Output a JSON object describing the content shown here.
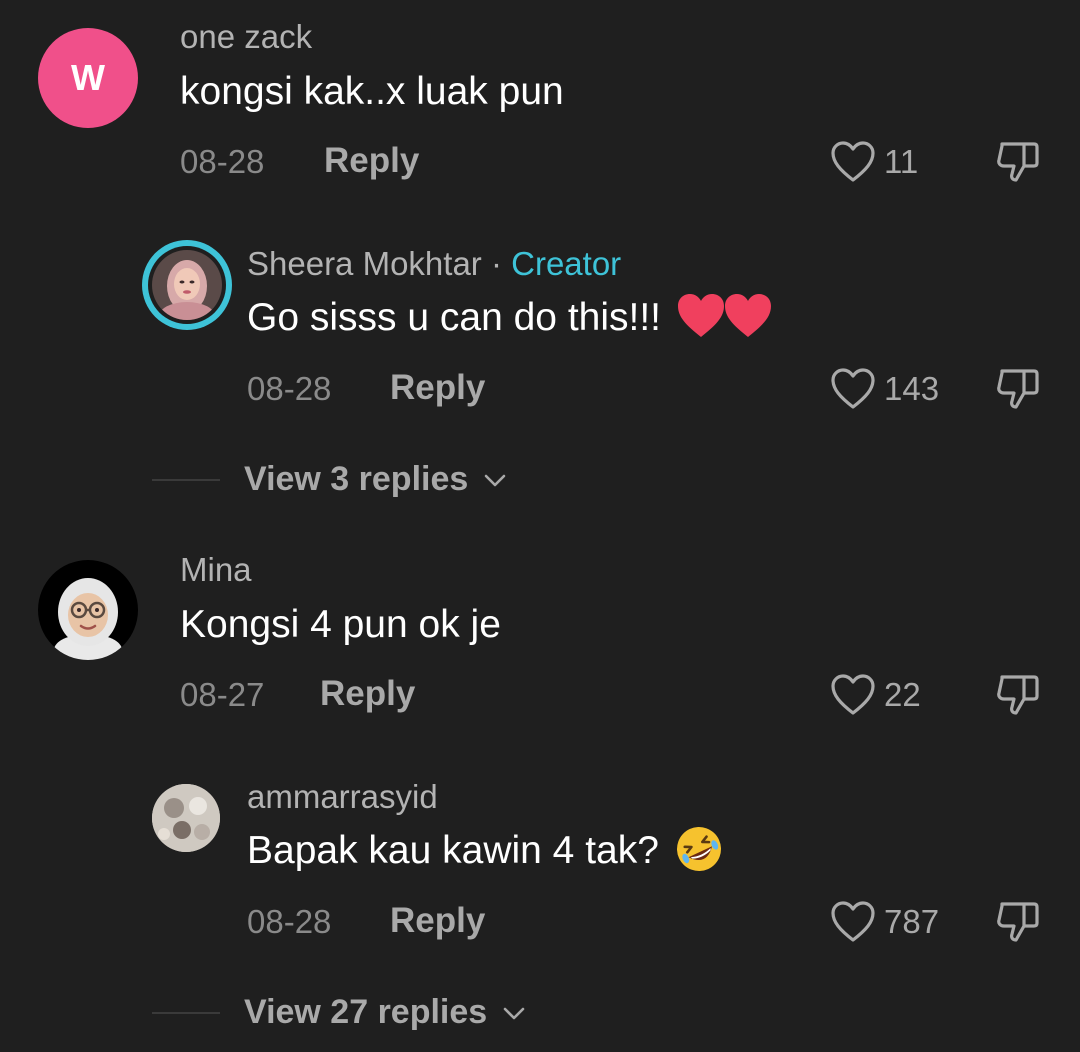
{
  "comments": [
    {
      "username": "one zack",
      "avatar_letter": "W",
      "avatar_color": "#f0508a",
      "text": "kongsi kak..x luak pun",
      "date": "08-28",
      "reply_label": "Reply",
      "likes": "11"
    },
    {
      "username": "Sheera Mokhtar",
      "separator": " · ",
      "creator_badge": "Creator",
      "text": "Go sisss u can do this!!!",
      "text_emoji": "two-red-hearts",
      "date": "08-28",
      "reply_label": "Reply",
      "likes": "143"
    },
    {
      "view_replies": "View 3 replies"
    },
    {
      "username": "Mina",
      "text": "Kongsi 4 pun ok je",
      "date": "08-27",
      "reply_label": "Reply",
      "likes": "22"
    },
    {
      "username": "ammarrasyid",
      "text": "Bapak kau kawin 4 tak?",
      "text_emoji": "rolling-on-floor-laughing",
      "date": "08-28",
      "reply_label": "Reply",
      "likes": "787"
    },
    {
      "view_replies": "View 27 replies"
    }
  ],
  "colors": {
    "background": "#1f1f1f",
    "creator": "#3ec3d8",
    "avatar_ring": "#3ec3d8"
  }
}
